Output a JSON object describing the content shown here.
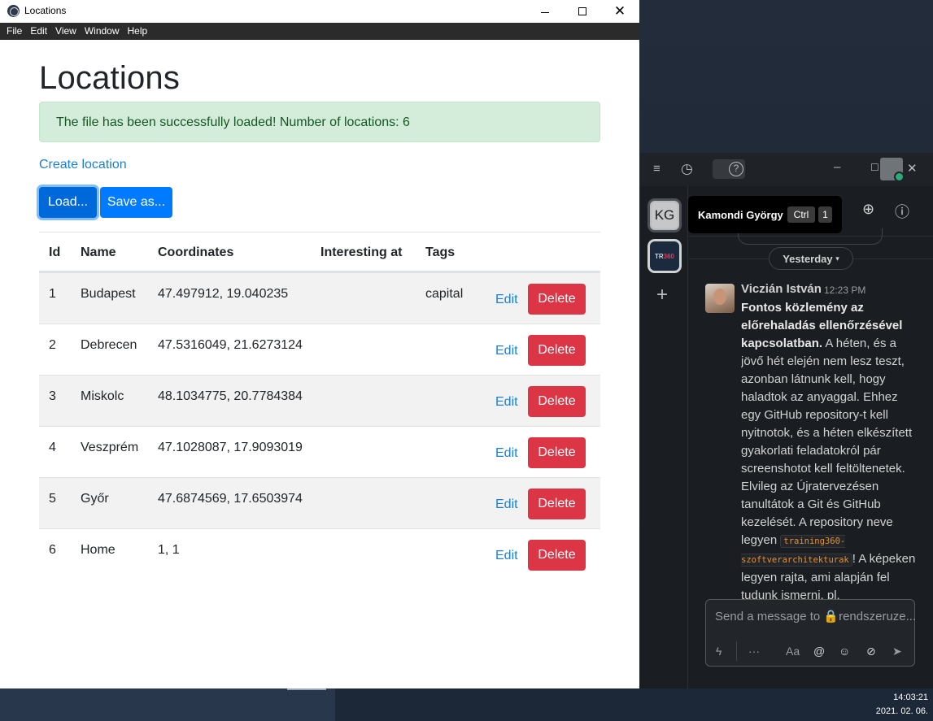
{
  "window": {
    "title": "Locations",
    "menu": [
      "File",
      "Edit",
      "View",
      "Window",
      "Help"
    ]
  },
  "page": {
    "heading": "Locations",
    "alert": "The file has been successfully loaded! Number of locations: 6",
    "create_link": "Create location",
    "load_button": "Load...",
    "save_button": "Save as...",
    "table": {
      "headers": [
        "Id",
        "Name",
        "Coordinates",
        "Interesting at",
        "Tags"
      ],
      "edit_label": "Edit",
      "delete_label": "Delete",
      "rows": [
        {
          "id": "1",
          "name": "Budapest",
          "coordinates": "47.497912, 19.040235",
          "interesting_at": "",
          "tags": "capital"
        },
        {
          "id": "2",
          "name": "Debrecen",
          "coordinates": "47.5316049, 21.6273124",
          "interesting_at": "",
          "tags": ""
        },
        {
          "id": "3",
          "name": "Miskolc",
          "coordinates": "48.1034775, 20.7784384",
          "interesting_at": "",
          "tags": ""
        },
        {
          "id": "4",
          "name": "Veszprém",
          "coordinates": "47.1028087, 17.9093019",
          "interesting_at": "",
          "tags": ""
        },
        {
          "id": "5",
          "name": "Győr",
          "coordinates": "47.6874569, 17.6503974",
          "interesting_at": "",
          "tags": ""
        },
        {
          "id": "6",
          "name": "Home",
          "coordinates": "1, 1",
          "interesting_at": "",
          "tags": ""
        }
      ]
    }
  },
  "chat": {
    "workspace_initials": "KG",
    "workspace2_label": "TR",
    "workspace2_label_accent": "360",
    "tooltip": {
      "name": "Kamondi György",
      "key1": "Ctrl",
      "key2": "1"
    },
    "date_divider": "Yesterday",
    "message": {
      "author": "Viczián István",
      "time": "12:23 PM",
      "bold_intro": "Fontos közlemény az előrehaladás ellenőrzésével kapcsolatban.",
      "text1": " A héten, és a jövő hét elején nem lesz teszt, azonban látnunk kell, hogy haladtok az anyaggal. Ehhez egy GitHub repository-t kell nyitnotok, és a héten elkészített gyakorlati feladatokról pár screenshotot kell feltöltenetek. Elvileg az Újratervezésen tanultátok a Git és GitHub kezelését. A repository neve legyen ",
      "code": "training360-szoftverarchitekturak",
      "text2": "! A képeken legyen rajta, ami alapján fel tudunk ismerni, pl."
    },
    "composer_placeholder": "Send a message to 🔒rendszeruze...",
    "composer_tools": [
      "lightning-icon",
      "more-icon",
      "format-icon",
      "mention-icon",
      "emoji-icon",
      "attach-icon",
      "send-icon"
    ]
  },
  "taskbar": {
    "time": "14:03:21",
    "date": "2021. 02. 06."
  },
  "colors": {
    "primary": "#007bff",
    "danger": "#dc3545",
    "link": "#1a7fd4",
    "alert_bg": "#d4edda",
    "alert_text": "#155724",
    "chat_bg": "#1a1d21"
  }
}
